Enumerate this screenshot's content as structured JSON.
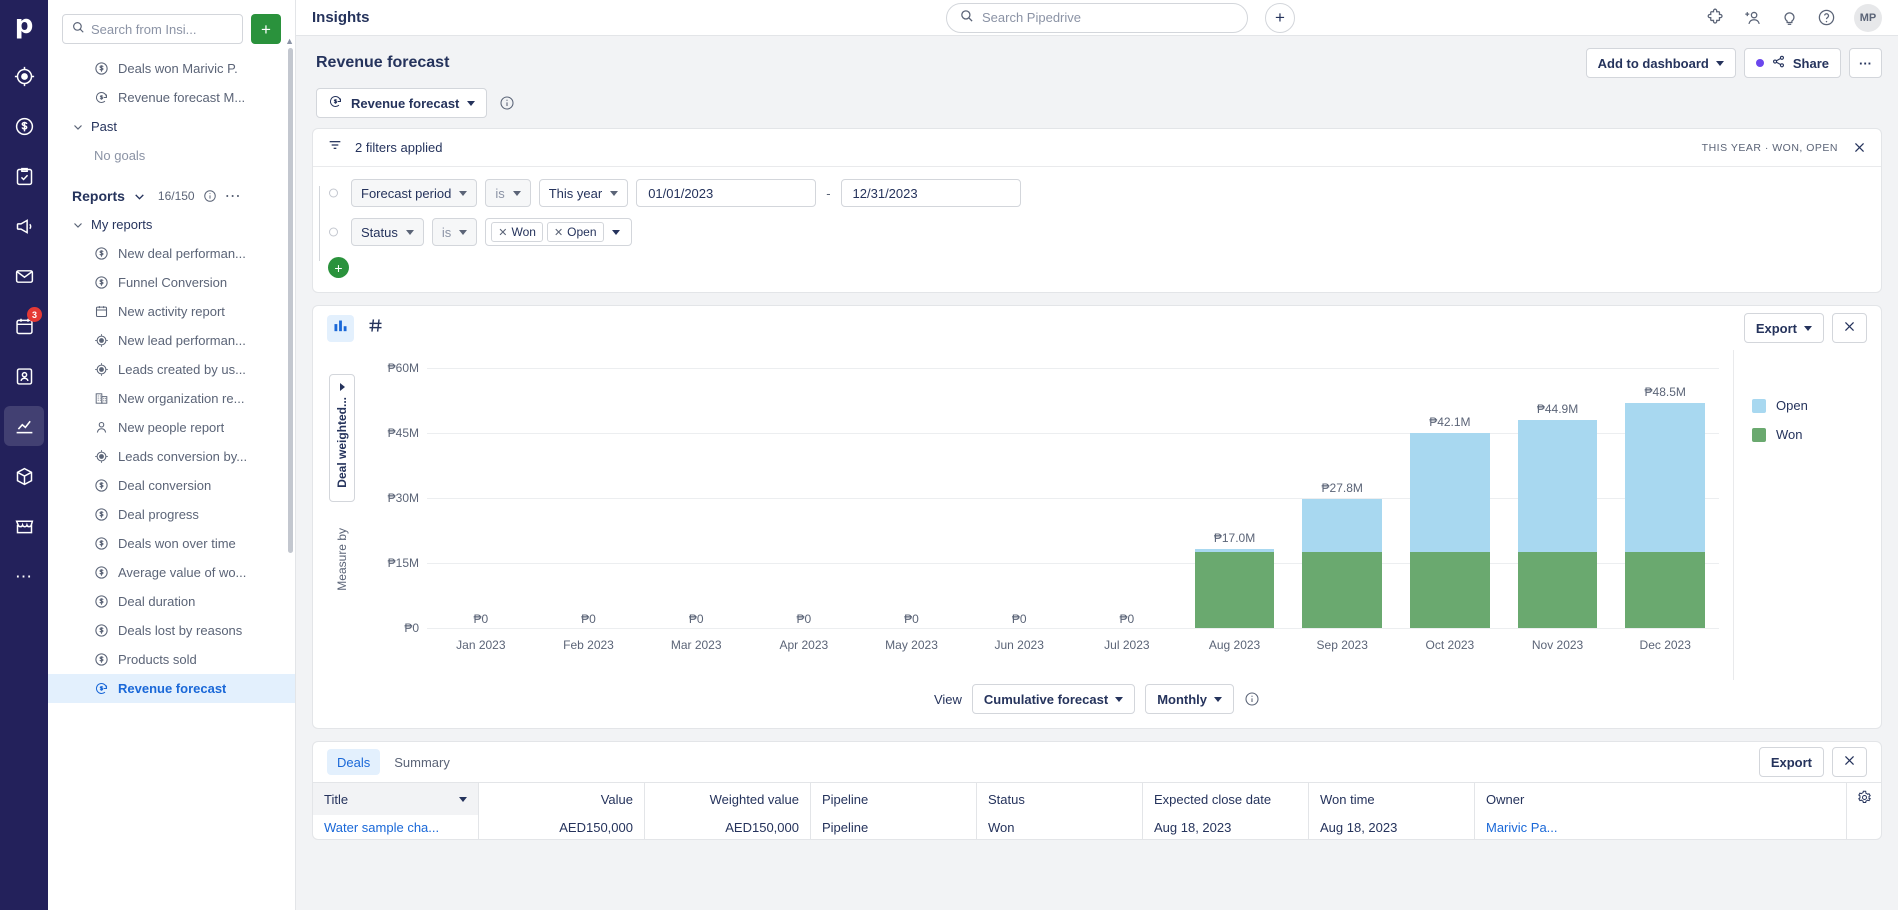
{
  "rail": {
    "logo": "p",
    "items": [
      {
        "name": "leads-icon",
        "badge": null
      },
      {
        "name": "deals-icon",
        "badge": null
      },
      {
        "name": "projects-icon",
        "badge": null
      },
      {
        "name": "campaigns-icon",
        "badge": null
      },
      {
        "name": "mail-icon",
        "badge": null
      },
      {
        "name": "activities-icon",
        "badge": "3"
      },
      {
        "name": "contacts-icon",
        "badge": null
      },
      {
        "name": "insights-icon",
        "badge": null
      },
      {
        "name": "products-icon",
        "badge": null
      },
      {
        "name": "marketplace-icon",
        "badge": null
      },
      {
        "name": "more-icon",
        "badge": null
      }
    ]
  },
  "topbar": {
    "title": "Insights",
    "search_placeholder": "Search Pipedrive",
    "search_value": "",
    "add_label": "+",
    "icons": [
      "puzzle-icon",
      "add-person-icon",
      "lightbulb-icon",
      "help-icon"
    ],
    "avatar_initials": "MP"
  },
  "sidebar": {
    "search_placeholder": "Search from Insi...",
    "search_value": "",
    "add_label": "+",
    "goals": [
      {
        "label": "Deals won Marivic P.",
        "icon": "dollar-circle-icon"
      },
      {
        "label": "Revenue forecast M...",
        "icon": "forecast-icon"
      }
    ],
    "past_group": {
      "label": "Past",
      "empty": "No goals"
    },
    "reports_section": {
      "title": "Reports",
      "count": "16/150"
    },
    "my_reports_group": "My reports",
    "reports": [
      {
        "label": "New deal performan...",
        "icon": "dollar-circle-icon",
        "active": false
      },
      {
        "label": "Funnel Conversion",
        "icon": "dollar-circle-icon",
        "active": false
      },
      {
        "label": "New activity report",
        "icon": "calendar-icon",
        "active": false
      },
      {
        "label": "New lead performan...",
        "icon": "target-icon",
        "active": false
      },
      {
        "label": "Leads created by us...",
        "icon": "target-icon",
        "active": false
      },
      {
        "label": "New organization re...",
        "icon": "building-icon",
        "active": false
      },
      {
        "label": "New people report",
        "icon": "person-icon",
        "active": false
      },
      {
        "label": "Leads conversion by...",
        "icon": "target-icon",
        "active": false
      },
      {
        "label": "Deal conversion",
        "icon": "dollar-circle-icon",
        "active": false
      },
      {
        "label": "Deal progress",
        "icon": "dollar-circle-icon",
        "active": false
      },
      {
        "label": "Deals won over time",
        "icon": "dollar-circle-icon",
        "active": false
      },
      {
        "label": "Average value of wo...",
        "icon": "dollar-circle-icon",
        "active": false
      },
      {
        "label": "Deal duration",
        "icon": "dollar-circle-icon",
        "active": false
      },
      {
        "label": "Deals lost by reasons",
        "icon": "dollar-circle-icon",
        "active": false
      },
      {
        "label": "Products sold",
        "icon": "dollar-circle-icon",
        "active": false
      },
      {
        "label": "Revenue forecast",
        "icon": "forecast-icon",
        "active": true
      }
    ]
  },
  "page": {
    "title": "Revenue forecast",
    "report_chip": "Revenue forecast",
    "add_to_dashboard": "Add to dashboard",
    "share": "Share",
    "more": "···"
  },
  "filters": {
    "header": "2 filters applied",
    "meta": "THIS YEAR · WON, OPEN",
    "rows": [
      {
        "field": "Forecast period",
        "operator": "is",
        "preset": "This year",
        "date_from": "01/01/2023",
        "date_to": "12/31/2023",
        "separator": "-"
      },
      {
        "field": "Status",
        "operator": "is",
        "tags": [
          "Won",
          "Open"
        ]
      }
    ],
    "add_label": "+"
  },
  "chart_panel": {
    "export": "Export",
    "measure_select": "Deal weighted...",
    "measure_by_label": "Measure by",
    "view_label": "View",
    "view_mode": "Cumulative forecast",
    "interval": "Monthly"
  },
  "chart_data": {
    "type": "bar",
    "stacked": true,
    "title": "Revenue forecast",
    "xlabel": "",
    "ylabel": "Deal weighted value",
    "currency_symbol": "₱",
    "categories": [
      "Jan 2023",
      "Feb 2023",
      "Mar 2023",
      "Apr 2023",
      "May 2023",
      "Jun 2023",
      "Jul 2023",
      "Aug 2023",
      "Sep 2023",
      "Oct 2023",
      "Nov 2023",
      "Dec 2023"
    ],
    "ylim": [
      0,
      60
    ],
    "yticks": [
      0,
      15,
      30,
      45,
      60
    ],
    "ytick_labels": [
      "₱0",
      "₱15M",
      "₱30M",
      "₱45M",
      "₱60M"
    ],
    "grid": true,
    "legend_position": "right",
    "legend": [
      "Open",
      "Won"
    ],
    "series": [
      {
        "name": "Won",
        "color": "#6aa96f",
        "values": [
          0,
          0,
          0,
          0,
          0,
          0,
          0,
          16.5,
          16.5,
          16.5,
          16.5,
          16.5
        ]
      },
      {
        "name": "Open",
        "color": "#a8d8f0",
        "values": [
          0,
          0,
          0,
          0,
          0,
          0,
          0,
          0.5,
          11.3,
          25.6,
          28.4,
          32.0
        ]
      }
    ],
    "totals": [
      0,
      0,
      0,
      0,
      0,
      0,
      0,
      17.0,
      27.8,
      42.1,
      44.9,
      48.5
    ],
    "data_labels": [
      "₱0",
      "₱0",
      "₱0",
      "₱0",
      "₱0",
      "₱0",
      "₱0",
      "₱17.0M",
      "₱27.8M",
      "₱42.1M",
      "₱44.9M",
      "₱48.5M"
    ]
  },
  "table": {
    "tabs": [
      {
        "label": "Deals",
        "active": true
      },
      {
        "label": "Summary",
        "active": false
      }
    ],
    "export": "Export",
    "columns": [
      "Title",
      "Value",
      "Weighted value",
      "Pipeline",
      "Status",
      "Expected close date",
      "Won time",
      "Owner"
    ],
    "sorted_column": "Title",
    "first_row": {
      "title": "Water sample cha...",
      "value": "AED150,000",
      "weighted_value": "AED150,000",
      "pipeline": "Pipeline",
      "status": "Won",
      "expected_close_date": "Aug 18, 2023",
      "won_time": "Aug 18, 2023",
      "owner": "Marivic Pa..."
    }
  },
  "colors": {
    "brand": "#23215b",
    "accent_blue": "#1a68d8",
    "green": "#2a923c",
    "open_bar": "#a8d8f0",
    "won_bar": "#6aa96f",
    "purple_dot": "#6b47ed"
  }
}
